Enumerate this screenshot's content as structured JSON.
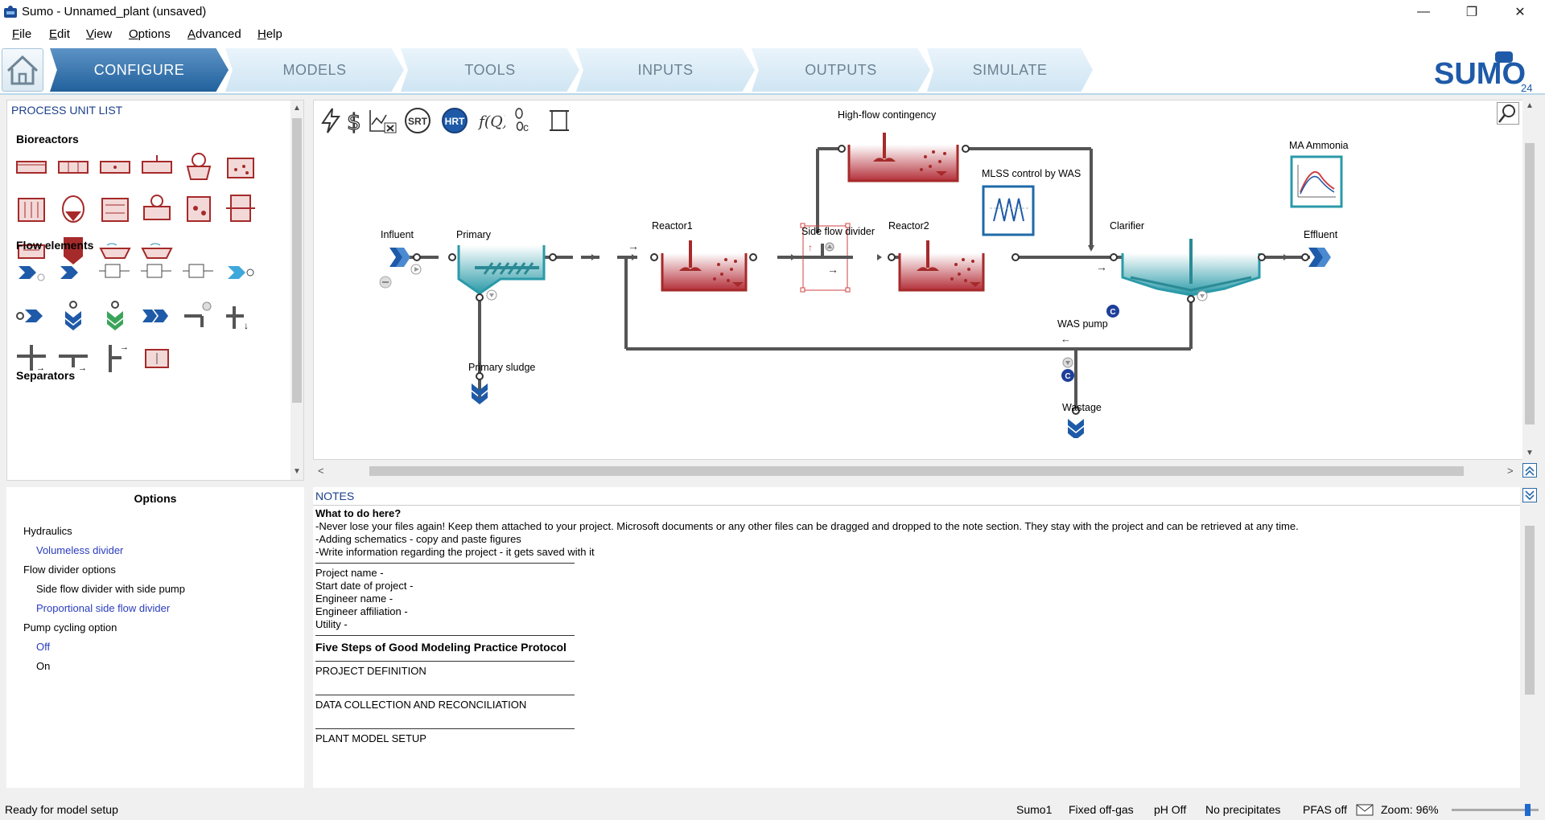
{
  "window": {
    "title": "Sumo - Unnamed_plant (unsaved)",
    "minimize": "—",
    "restore": "❐",
    "close": "✕"
  },
  "menu": [
    "File",
    "Edit",
    "View",
    "Options",
    "Advanced",
    "Help"
  ],
  "tabs": [
    {
      "label": "CONFIGURE",
      "active": true
    },
    {
      "label": "MODELS",
      "active": false
    },
    {
      "label": "TOOLS",
      "active": false
    },
    {
      "label": "INPUTS",
      "active": false
    },
    {
      "label": "OUTPUTS",
      "active": false
    },
    {
      "label": "SIMULATE",
      "active": false
    }
  ],
  "logo": {
    "text": "SUMO",
    "version": "24"
  },
  "left_panel": {
    "title": "PROCESS UNIT LIST",
    "sections": [
      "Bioreactors",
      "Flow elements",
      "Separators"
    ]
  },
  "options_panel": {
    "title": "Options",
    "items": [
      {
        "text": "Hydraulics",
        "type": "group"
      },
      {
        "text": "Volumeless divider",
        "type": "selected"
      },
      {
        "text": "Flow divider options",
        "type": "group"
      },
      {
        "text": "Side flow divider with side pump",
        "type": "option"
      },
      {
        "text": "Proportional side flow divider",
        "type": "selected"
      },
      {
        "text": "Pump cycling option",
        "type": "group"
      },
      {
        "text": "Off",
        "type": "selected"
      },
      {
        "text": "On",
        "type": "option"
      }
    ]
  },
  "toolbar_icons": [
    "lightning-icon",
    "dollar-icon",
    "chart-cancel-icon",
    "srt-icon",
    "hrt-icon",
    "function-icon",
    "footprint-icon",
    "scroll-icon"
  ],
  "toolbar_text": {
    "srt": "SRT",
    "hrt": "HRT",
    "fq": "f(Q)"
  },
  "diagram": {
    "labels": {
      "influent": "Influent",
      "primary": "Primary",
      "primary_sludge": "Primary sludge",
      "reactor1": "Reactor1",
      "side_flow_divider": "Side flow divider",
      "reactor2": "Reactor2",
      "high_flow": "High-flow contingency",
      "mlss_control": "MLSS control by WAS",
      "ma_ammonia": "MA Ammonia",
      "clarifier": "Clarifier",
      "effluent": "Effluent",
      "was_pump": "WAS pump",
      "wastage": "Wastage"
    },
    "controller_badge": "C"
  },
  "notes": {
    "title": "NOTES",
    "lines": [
      {
        "text": "What to do here?",
        "style": "bold"
      },
      {
        "text": "-Never lose your files again! Keep them attached to your project. Microsoft documents or any other files can be dragged and dropped to the note section. They stay with the project and can be retrieved at any time.",
        "style": "normal"
      },
      {
        "text": "-Adding schematics - copy and paste figures",
        "style": "normal"
      },
      {
        "text": "-Write information regarding the project - it gets saved with it",
        "style": "normal"
      },
      {
        "text": "",
        "style": "rule"
      },
      {
        "text": "Project name -",
        "style": "normal"
      },
      {
        "text": "Start date of project -",
        "style": "normal"
      },
      {
        "text": "Engineer name -",
        "style": "normal"
      },
      {
        "text": "Engineer affiliation -",
        "style": "normal"
      },
      {
        "text": "Utility -",
        "style": "normal"
      },
      {
        "text": "",
        "style": "rule"
      },
      {
        "text": "Five Steps of Good Modeling Practice Protocol",
        "style": "heading"
      },
      {
        "text": "",
        "style": "rule"
      },
      {
        "text": "PROJECT DEFINITION",
        "style": "normal"
      },
      {
        "text": "",
        "style": "spacer"
      },
      {
        "text": "",
        "style": "rule"
      },
      {
        "text": "DATA COLLECTION AND RECONCILIATION",
        "style": "normal"
      },
      {
        "text": "",
        "style": "spacer"
      },
      {
        "text": "",
        "style": "rule"
      },
      {
        "text": "PLANT MODEL SETUP",
        "style": "normal"
      }
    ]
  },
  "status": {
    "left": "Ready for model setup",
    "items": [
      "Sumo1",
      "Fixed off-gas",
      "pH Off",
      "No precipitates",
      "PFAS off"
    ],
    "zoom": "Zoom: 96%",
    "zoom_level": 0.9
  }
}
